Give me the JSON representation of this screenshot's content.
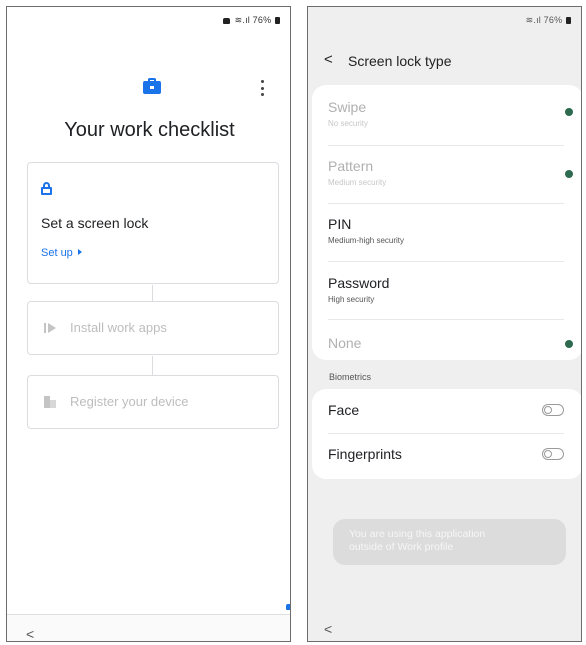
{
  "left": {
    "status": {
      "text": "76%"
    },
    "title": "Your work checklist",
    "cards": {
      "screen_lock": {
        "title": "Set a screen lock",
        "action": "Set up"
      },
      "install_apps": {
        "label": "Install work apps"
      },
      "register_device": {
        "label": "Register your device"
      }
    },
    "nav": {
      "back": "<"
    },
    "icons": {
      "briefcase": "briefcase-icon",
      "menu": "more-vert-icon",
      "lock": "lock-icon",
      "apps": "play-store-icon",
      "device": "building-icon"
    },
    "accent": "#1a73e8"
  },
  "right": {
    "status": {
      "text": "76%"
    },
    "header": {
      "back": "<",
      "title": "Screen lock type"
    },
    "options": [
      {
        "title": "Swipe",
        "subtitle": "No security",
        "disabled": true,
        "info": true
      },
      {
        "title": "Pattern",
        "subtitle": "Medium security",
        "disabled": true,
        "info": true
      },
      {
        "title": "PIN",
        "subtitle": "Medium-high security",
        "disabled": false,
        "info": false
      },
      {
        "title": "Password",
        "subtitle": "High security",
        "disabled": false,
        "info": false
      },
      {
        "title": "None",
        "subtitle": "",
        "disabled": true,
        "info": true
      }
    ],
    "biometrics": {
      "label": "Biometrics",
      "items": [
        {
          "title": "Face",
          "enabled": false
        },
        {
          "title": "Fingerprints",
          "enabled": false
        }
      ]
    },
    "toast": {
      "line1": "You are using this application",
      "line2": "outside of Work profile"
    },
    "nav": {
      "back": "<"
    },
    "info_color": "#2d6a4f"
  }
}
